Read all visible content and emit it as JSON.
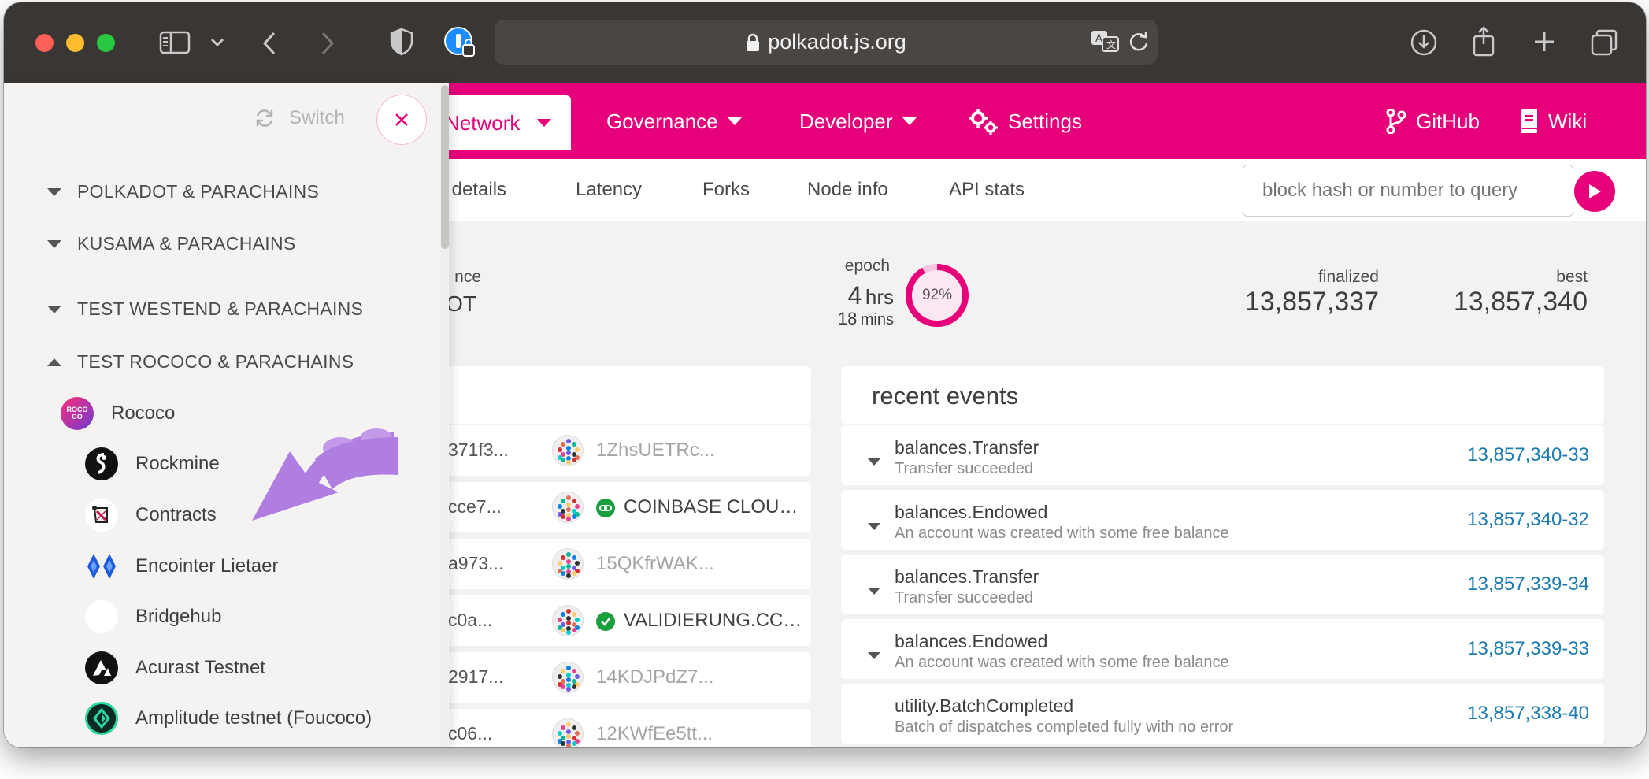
{
  "browser": {
    "url": "polkadot.js.org"
  },
  "nav": {
    "active": "Network",
    "items": [
      "Governance",
      "Developer",
      "Settings"
    ],
    "right": [
      "GitHub",
      "Wiki"
    ],
    "brand_color": "#e6007a"
  },
  "subnav": {
    "items": [
      "k details",
      "Latency",
      "Forks",
      "Node info",
      "API stats"
    ],
    "query_placeholder": "block hash or number to query"
  },
  "stats": {
    "partial_label": "nce",
    "partial_value": "OT",
    "epoch_label": "epoch",
    "epoch_hours_value": "4",
    "epoch_hours_unit": "hrs",
    "epoch_mins_value": "18",
    "epoch_mins_unit": "mins",
    "epoch_percent_text": "92%",
    "epoch_progress": 0.92,
    "finalized_label": "finalized",
    "finalized_value": "13,857,337",
    "best_label": "best",
    "best_value": "13,857,340"
  },
  "recent_blocks": [
    {
      "hash": "371f3...",
      "author": "1ZhsUETRc...",
      "verified": false
    },
    {
      "hash": "cce7...",
      "author": "COINBASE CLOU…",
      "verified": true,
      "verified_style": "link"
    },
    {
      "hash": "a973...",
      "author": "15QKfrWAK...",
      "verified": false
    },
    {
      "hash": "c0a...",
      "author": "VALIDIERUNG.CC…",
      "verified": true,
      "verified_style": "check"
    },
    {
      "hash": "2917...",
      "author": "14KDJPdZ7...",
      "verified": false
    },
    {
      "hash": "c06...",
      "author": "12KWfEe5tt...",
      "verified": false
    }
  ],
  "recent_events": {
    "title": "recent events",
    "items": [
      {
        "name": "balances.Transfer",
        "desc": "Transfer succeeded",
        "ref": "13,857,340-33",
        "expandable": true
      },
      {
        "name": "balances.Endowed",
        "desc": "An account was created with some free balance",
        "ref": "13,857,340-32",
        "expandable": true
      },
      {
        "name": "balances.Transfer",
        "desc": "Transfer succeeded",
        "ref": "13,857,339-34",
        "expandable": true
      },
      {
        "name": "balances.Endowed",
        "desc": "An account was created with some free balance",
        "ref": "13,857,339-33",
        "expandable": true
      },
      {
        "name": "utility.BatchCompleted",
        "desc": "Batch of dispatches completed fully with no error",
        "ref": "13,857,338-40",
        "expandable": false
      }
    ]
  },
  "sidebar": {
    "switch_label": "Switch",
    "sections": [
      {
        "label": "POLKADOT & PARACHAINS",
        "expanded": false
      },
      {
        "label": "KUSAMA & PARACHAINS",
        "expanded": false
      },
      {
        "label": "TEST WESTEND & PARACHAINS",
        "expanded": false
      },
      {
        "label": "TEST ROCOCO & PARACHAINS",
        "expanded": true
      }
    ],
    "relay": {
      "label": "Rococo",
      "logo_text": "ROCOCO"
    },
    "chains": [
      {
        "label": "Rockmine",
        "icon": "rockmine-icon"
      },
      {
        "label": "Contracts",
        "icon": "contracts-scroll-icon"
      },
      {
        "label": "Encointer Lietaer",
        "icon": "encointer-icon"
      },
      {
        "label": "Bridgehub",
        "icon": "bridgehub-icon"
      },
      {
        "label": "Acurast Testnet",
        "icon": "acurast-icon"
      },
      {
        "label": "Amplitude testnet (Foucoco)",
        "icon": "amplitude-icon"
      }
    ]
  },
  "annotation": {
    "color": "#b07ee0",
    "icon": "purple-arrow-annotation"
  }
}
